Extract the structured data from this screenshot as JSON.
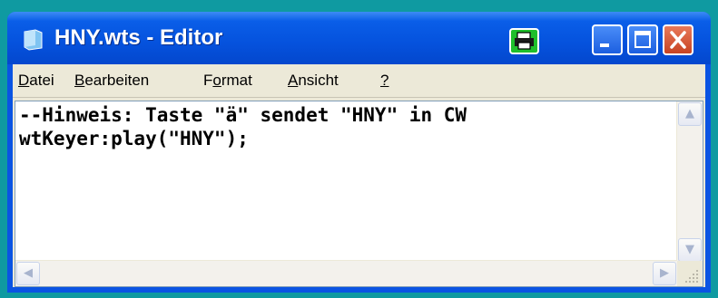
{
  "window": {
    "title": "HNY.wts - Editor",
    "colors": {
      "titlebar": "#0552dd",
      "close_button": "#d9532f",
      "desktop": "#0f9aa1"
    }
  },
  "menu": {
    "items": [
      {
        "acc": "D",
        "rest": "atei"
      },
      {
        "acc": "B",
        "rest": "earbeiten"
      },
      {
        "pre": "F",
        "acc": "o",
        "rest": "rmat"
      },
      {
        "acc": "A",
        "rest": "nsicht"
      },
      {
        "acc": "?",
        "rest": ""
      }
    ]
  },
  "editor": {
    "lines": [
      "--Hinweis: Taste \"ä\" sendet \"HNY\" in CW",
      "wtKeyer:play(\"HNY\");"
    ]
  },
  "icons": {
    "app": "notepad-icon",
    "tray": "printer-icon",
    "scroll_up": "▲",
    "scroll_down": "▼",
    "scroll_left": "◀",
    "scroll_right": "▶"
  }
}
